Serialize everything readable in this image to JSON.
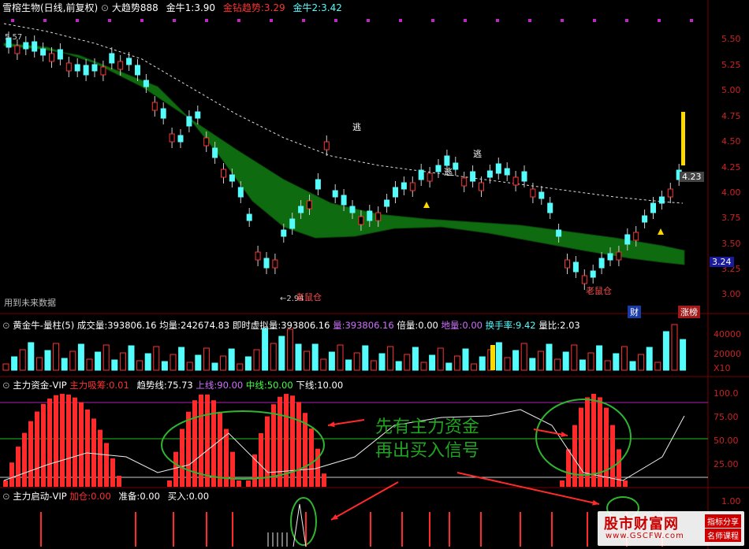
{
  "header_main": {
    "stock": "雪榕生物(日线,前复权)",
    "trend_label": "大趋势888",
    "jn1_label": "金牛1:",
    "jn1_value": "3.90",
    "jz_label": "金钻趋势:",
    "jz_value": "3.29",
    "jn2_label": "金牛2:",
    "jn2_value": "3.42"
  },
  "price_axis": [
    "5.50",
    "5.25",
    "5.00",
    "4.75",
    "4.50",
    "4.25",
    "4.00",
    "3.75",
    "3.50",
    "3.25",
    "3.00"
  ],
  "price_tags": {
    "high_marker": "5.57",
    "current_price": "4.23",
    "jz_price": "3.24",
    "low_marker": "←2.94",
    "future_data": "用到未来数据",
    "cai": "财",
    "zhangting": "涨榜"
  },
  "signals": {
    "escape": "逃",
    "old_mouse": "老鼠仓"
  },
  "header_volume": {
    "title": "黄金牛-量柱(5)",
    "vol_label": "成交量:",
    "vol_value": "393806.16",
    "avg_label": "均量:",
    "avg_value": "242674.83",
    "imm_label": "即时虚拟量:",
    "imm_value": "393806.16",
    "liang_label": "量:",
    "liang_value": "393806.16",
    "bei_label": "倍量:",
    "bei_value": "0.00",
    "di_label": "地量:",
    "di_value": "0.00",
    "hs_label": "换手率:",
    "hs_value": "9.42",
    "lb_label": "量比:",
    "lb_value": "2.03"
  },
  "volume_axis": [
    "40000",
    "20000",
    "X10"
  ],
  "header_capital": {
    "title": "主力资金-VIP",
    "xc_label": "主力吸筹:",
    "xc_value": "0.01",
    "trend_label": "趋势线:",
    "trend_value": "75.73",
    "up_label": "上线:",
    "up_value": "90.00",
    "mid_label": "中线:",
    "mid_value": "50.00",
    "low_label": "下线:",
    "low_value": "10.00"
  },
  "capital_axis": [
    "100.0",
    "75.00",
    "50.00",
    "25.00"
  ],
  "annotation": {
    "line1": "先有主力资金",
    "line2": "再出买入信号"
  },
  "header_start": {
    "title": "主力启动-VIP",
    "jc_label": "加仓:",
    "jc_value": "0.00",
    "zb_label": "准备:",
    "zb_value": "0.00",
    "mr_label": "买入:",
    "mr_value": "0.00"
  },
  "start_axis": [
    "1.00"
  ],
  "watermark": {
    "brand": "股市财富网",
    "url": "www.GSCFW.com",
    "badge1": "指标分享",
    "badge2": "名师课程"
  },
  "colors": {
    "up": "#ff3232",
    "down": "#54fcfc",
    "band": "#0f6b0f",
    "grid": "#7a0000"
  }
}
